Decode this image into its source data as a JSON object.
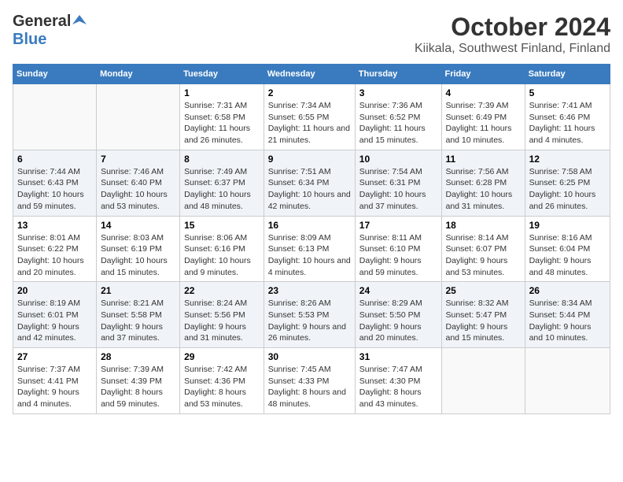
{
  "header": {
    "logo_general": "General",
    "logo_blue": "Blue",
    "month_title": "October 2024",
    "location": "Kiikala, Southwest Finland, Finland"
  },
  "calendar": {
    "days_of_week": [
      "Sunday",
      "Monday",
      "Tuesday",
      "Wednesday",
      "Thursday",
      "Friday",
      "Saturday"
    ],
    "weeks": [
      [
        {
          "day": "",
          "info": ""
        },
        {
          "day": "",
          "info": ""
        },
        {
          "day": "1",
          "info": "Sunrise: 7:31 AM\nSunset: 6:58 PM\nDaylight: 11 hours and 26 minutes."
        },
        {
          "day": "2",
          "info": "Sunrise: 7:34 AM\nSunset: 6:55 PM\nDaylight: 11 hours and 21 minutes."
        },
        {
          "day": "3",
          "info": "Sunrise: 7:36 AM\nSunset: 6:52 PM\nDaylight: 11 hours and 15 minutes."
        },
        {
          "day": "4",
          "info": "Sunrise: 7:39 AM\nSunset: 6:49 PM\nDaylight: 11 hours and 10 minutes."
        },
        {
          "day": "5",
          "info": "Sunrise: 7:41 AM\nSunset: 6:46 PM\nDaylight: 11 hours and 4 minutes."
        }
      ],
      [
        {
          "day": "6",
          "info": "Sunrise: 7:44 AM\nSunset: 6:43 PM\nDaylight: 10 hours and 59 minutes."
        },
        {
          "day": "7",
          "info": "Sunrise: 7:46 AM\nSunset: 6:40 PM\nDaylight: 10 hours and 53 minutes."
        },
        {
          "day": "8",
          "info": "Sunrise: 7:49 AM\nSunset: 6:37 PM\nDaylight: 10 hours and 48 minutes."
        },
        {
          "day": "9",
          "info": "Sunrise: 7:51 AM\nSunset: 6:34 PM\nDaylight: 10 hours and 42 minutes."
        },
        {
          "day": "10",
          "info": "Sunrise: 7:54 AM\nSunset: 6:31 PM\nDaylight: 10 hours and 37 minutes."
        },
        {
          "day": "11",
          "info": "Sunrise: 7:56 AM\nSunset: 6:28 PM\nDaylight: 10 hours and 31 minutes."
        },
        {
          "day": "12",
          "info": "Sunrise: 7:58 AM\nSunset: 6:25 PM\nDaylight: 10 hours and 26 minutes."
        }
      ],
      [
        {
          "day": "13",
          "info": "Sunrise: 8:01 AM\nSunset: 6:22 PM\nDaylight: 10 hours and 20 minutes."
        },
        {
          "day": "14",
          "info": "Sunrise: 8:03 AM\nSunset: 6:19 PM\nDaylight: 10 hours and 15 minutes."
        },
        {
          "day": "15",
          "info": "Sunrise: 8:06 AM\nSunset: 6:16 PM\nDaylight: 10 hours and 9 minutes."
        },
        {
          "day": "16",
          "info": "Sunrise: 8:09 AM\nSunset: 6:13 PM\nDaylight: 10 hours and 4 minutes."
        },
        {
          "day": "17",
          "info": "Sunrise: 8:11 AM\nSunset: 6:10 PM\nDaylight: 9 hours and 59 minutes."
        },
        {
          "day": "18",
          "info": "Sunrise: 8:14 AM\nSunset: 6:07 PM\nDaylight: 9 hours and 53 minutes."
        },
        {
          "day": "19",
          "info": "Sunrise: 8:16 AM\nSunset: 6:04 PM\nDaylight: 9 hours and 48 minutes."
        }
      ],
      [
        {
          "day": "20",
          "info": "Sunrise: 8:19 AM\nSunset: 6:01 PM\nDaylight: 9 hours and 42 minutes."
        },
        {
          "day": "21",
          "info": "Sunrise: 8:21 AM\nSunset: 5:58 PM\nDaylight: 9 hours and 37 minutes."
        },
        {
          "day": "22",
          "info": "Sunrise: 8:24 AM\nSunset: 5:56 PM\nDaylight: 9 hours and 31 minutes."
        },
        {
          "day": "23",
          "info": "Sunrise: 8:26 AM\nSunset: 5:53 PM\nDaylight: 9 hours and 26 minutes."
        },
        {
          "day": "24",
          "info": "Sunrise: 8:29 AM\nSunset: 5:50 PM\nDaylight: 9 hours and 20 minutes."
        },
        {
          "day": "25",
          "info": "Sunrise: 8:32 AM\nSunset: 5:47 PM\nDaylight: 9 hours and 15 minutes."
        },
        {
          "day": "26",
          "info": "Sunrise: 8:34 AM\nSunset: 5:44 PM\nDaylight: 9 hours and 10 minutes."
        }
      ],
      [
        {
          "day": "27",
          "info": "Sunrise: 7:37 AM\nSunset: 4:41 PM\nDaylight: 9 hours and 4 minutes."
        },
        {
          "day": "28",
          "info": "Sunrise: 7:39 AM\nSunset: 4:39 PM\nDaylight: 8 hours and 59 minutes."
        },
        {
          "day": "29",
          "info": "Sunrise: 7:42 AM\nSunset: 4:36 PM\nDaylight: 8 hours and 53 minutes."
        },
        {
          "day": "30",
          "info": "Sunrise: 7:45 AM\nSunset: 4:33 PM\nDaylight: 8 hours and 48 minutes."
        },
        {
          "day": "31",
          "info": "Sunrise: 7:47 AM\nSunset: 4:30 PM\nDaylight: 8 hours and 43 minutes."
        },
        {
          "day": "",
          "info": ""
        },
        {
          "day": "",
          "info": ""
        }
      ]
    ]
  }
}
